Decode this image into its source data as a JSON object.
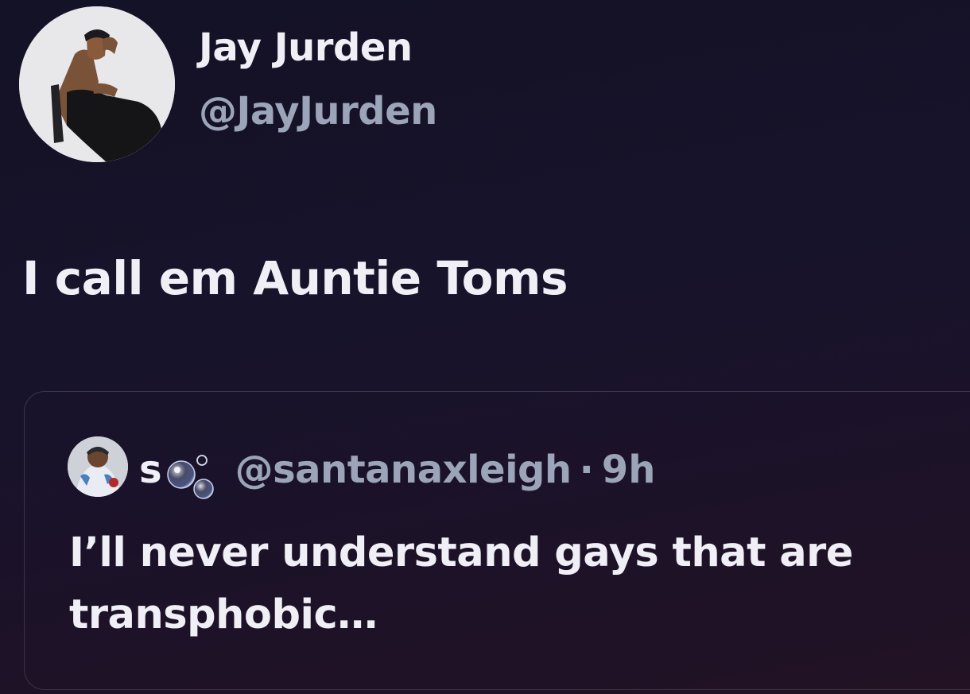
{
  "author": {
    "display_name": "Jay Jurden",
    "handle": "@JayJurden",
    "avatar_icon": "profile-photo"
  },
  "tweet": {
    "text": "I call em Auntie Toms"
  },
  "quoted_tweet": {
    "display_name": "s",
    "name_emoji": "bubbles-emoji",
    "handle": "@santanaxleigh",
    "separator": "·",
    "time": "9h",
    "text": "I’ll never understand gays that are transphobic…"
  },
  "colors": {
    "background": "#17132b",
    "primary_text": "#f1eff6",
    "secondary_text": "#9ba4b8",
    "border": "#3a3548"
  }
}
